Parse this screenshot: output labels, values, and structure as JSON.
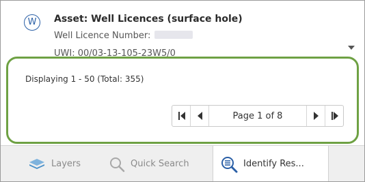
{
  "result": {
    "badge": "W",
    "title": "Asset: Well Licences (surface hole)",
    "licence_label": "Well Licence Number:",
    "uwi_text": "UWI: 00/03-13-105-23W5/0"
  },
  "pager": {
    "display_text": "Displaying 1 - 50 (Total: 355)",
    "page_label": "Page 1 of 8"
  },
  "tabs": [
    {
      "label": "Layers",
      "icon": "layers-icon"
    },
    {
      "label": "Quick Search",
      "icon": "search-icon"
    },
    {
      "label": "Identify Res...",
      "icon": "identify-icon"
    }
  ],
  "colors": {
    "highlight_outline": "#6ea143",
    "badge": "#2a5fa6",
    "layers_icon": "#4a90c8"
  }
}
